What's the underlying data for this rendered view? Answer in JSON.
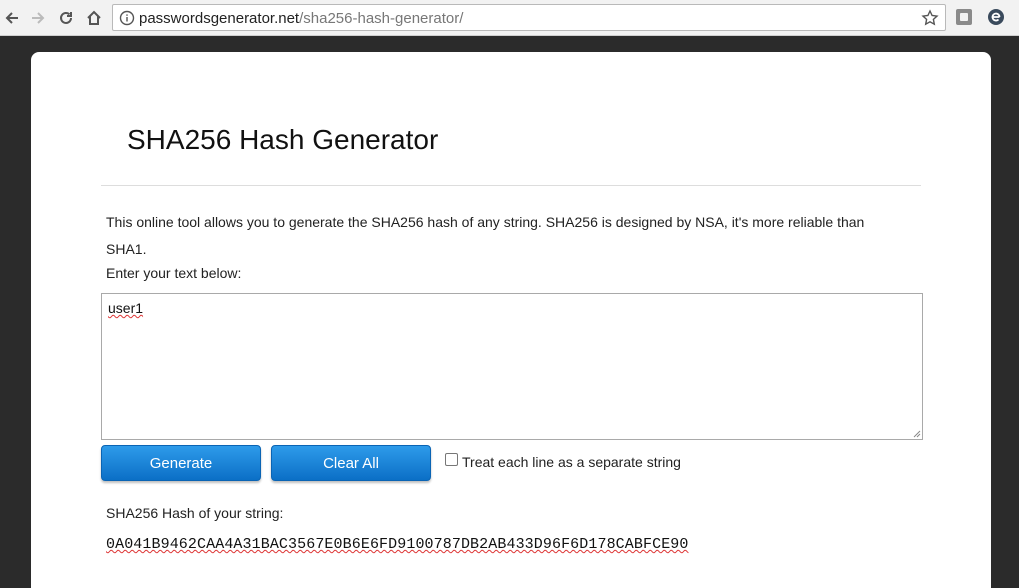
{
  "browser": {
    "url_host": "passwordsgenerator.net",
    "url_path": "/sha256-hash-generator/"
  },
  "page": {
    "title": "SHA256 Hash Generator",
    "description": "This online tool allows you to generate the SHA256 hash of any string. SHA256 is designed by NSA, it's more reliable than SHA1.",
    "prompt": "Enter your text below:",
    "input_value": "user1",
    "generate_label": "Generate",
    "clear_label": "Clear All",
    "checkbox_label": "Treat each line as a separate string",
    "checkbox_checked": false,
    "result_label": "SHA256 Hash of your string:",
    "hash_value": "0A041B9462CAA4A31BAC3567E0B6E6FD9100787DB2AB433D96F6D178CABFCE90"
  },
  "icons": {
    "back": "back-arrow-icon",
    "forward": "forward-arrow-icon",
    "reload": "reload-icon",
    "home": "home-icon",
    "info": "info-icon",
    "star": "star-icon"
  },
  "colors": {
    "button": "#1a84d8",
    "page_background": "#2b2b2b"
  }
}
